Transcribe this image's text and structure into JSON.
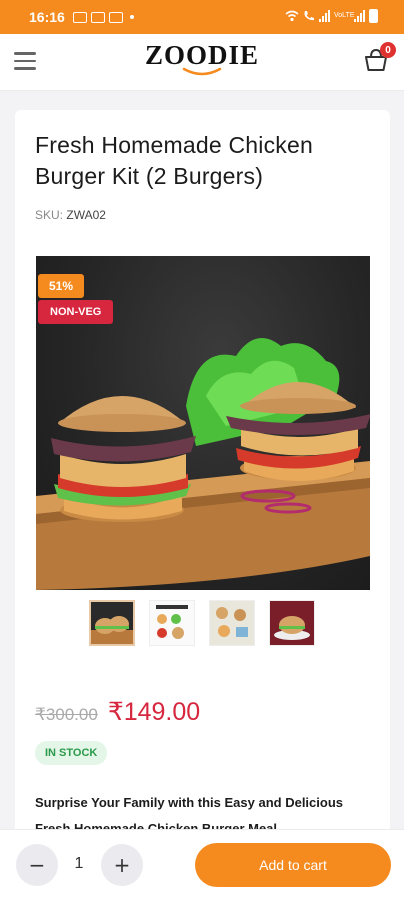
{
  "status_bar": {
    "time": "16:16",
    "network_label": "VoLTE"
  },
  "header": {
    "logo_text": "ZOODIE",
    "cart_count": "0"
  },
  "product": {
    "title": "Fresh Homemade Chicken Burger Kit (2 Burgers)",
    "sku_label": "SKU:",
    "sku_value": "ZWA02",
    "discount_badge": "51%",
    "veg_badge": "NON-VEG",
    "old_price": "₹300.00",
    "new_price": "₹149.00",
    "stock_status": "IN STOCK",
    "description": "Surprise Your Family with this Easy and Delicious Fresh Homemade Chicken Burger Meal"
  },
  "thumbnails": [
    "burger-photo",
    "meal-kit-card",
    "ingredients-photo",
    "plated-burger"
  ],
  "cart_bar": {
    "quantity": "1",
    "minus_label": "−",
    "plus_label": "+",
    "add_to_cart_label": "Add to cart"
  },
  "colors": {
    "accent": "#f58a1f",
    "price_red": "#d6273f",
    "stock_green": "#2b9a4b"
  }
}
